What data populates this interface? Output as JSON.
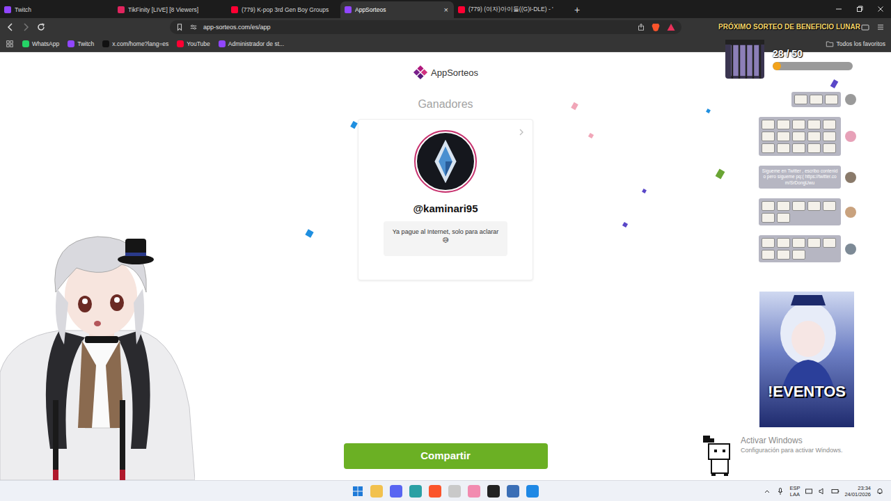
{
  "browser": {
    "tabs": [
      {
        "label": "Twitch",
        "selected": false,
        "color": "#9146ff"
      },
      {
        "label": "TikFinity [LIVE] [8 Viewers]",
        "selected": false,
        "color": "#e0245e"
      },
      {
        "label": "(779) K-pop 3rd Gen Boy Groups",
        "selected": false,
        "color": "#ff0033"
      },
      {
        "label": "AppSorteos",
        "selected": true,
        "color": "#9146ff"
      },
      {
        "label": "(779) (여자)아이들((G)I-DLE) - '",
        "selected": false,
        "color": "#ff0033"
      }
    ],
    "close_tab": "×",
    "new_tab": "+",
    "url": "app-sorteos.com/es/app",
    "bookmarks": [
      {
        "label": "WhatsApp",
        "color": "#25d366"
      },
      {
        "label": "Twitch",
        "color": "#9146ff"
      },
      {
        "label": "x.com/home?lang=es",
        "color": "#111111"
      },
      {
        "label": "YouTube",
        "color": "#ff0033"
      },
      {
        "label": "Administrador de st...",
        "color": "#9146ff"
      }
    ],
    "all_bookmarks": "Todos los favoritos"
  },
  "page": {
    "logo": "AppSorteos",
    "heading": "Ganadores",
    "winner": {
      "handle": "@kaminari95",
      "message": "Ya pague al Internet, solo para aclarar 😅"
    },
    "share_button": "Compartir"
  },
  "overlay": {
    "banner": "PRÓXIMO SORTEO DE BENEFICIO LUNAR",
    "counter": {
      "text": "28 / 50",
      "level": 0.1
    },
    "chat": [
      {
        "kind": "emotes",
        "emotes": 3,
        "color": "#9a9a9a"
      },
      {
        "kind": "emotes",
        "emotes": 15,
        "color": "#e7a1b8"
      },
      {
        "kind": "message",
        "text": "Sígueme en Twitter , escribo contenido pero sígueme pq:( https://twitter.com/SrDongUwu",
        "color": "#8a7a6a"
      },
      {
        "kind": "emotes",
        "emotes": 7,
        "color": "#c9a27e"
      },
      {
        "kind": "emotes",
        "emotes": 8,
        "color": "#7d8a96"
      }
    ],
    "events_card": "!EVENTOS"
  },
  "watermark": {
    "title": "Activar Windows",
    "subtitle": "Configuración para activar Windows."
  },
  "taskbar": {
    "apps": [
      {
        "color": "#f2c14e"
      },
      {
        "color": "#5865f2"
      },
      {
        "color": "#2aa0a4"
      },
      {
        "color": "#fb542b"
      },
      {
        "color": "#c9c9c9"
      },
      {
        "color": "#f28bb0"
      },
      {
        "color": "#222222"
      },
      {
        "color": "#3b6fb6"
      },
      {
        "color": "#1e88e5"
      }
    ],
    "language": "ESP",
    "layout": "LAA",
    "time": "23:34",
    "date": "24/01/2026"
  }
}
